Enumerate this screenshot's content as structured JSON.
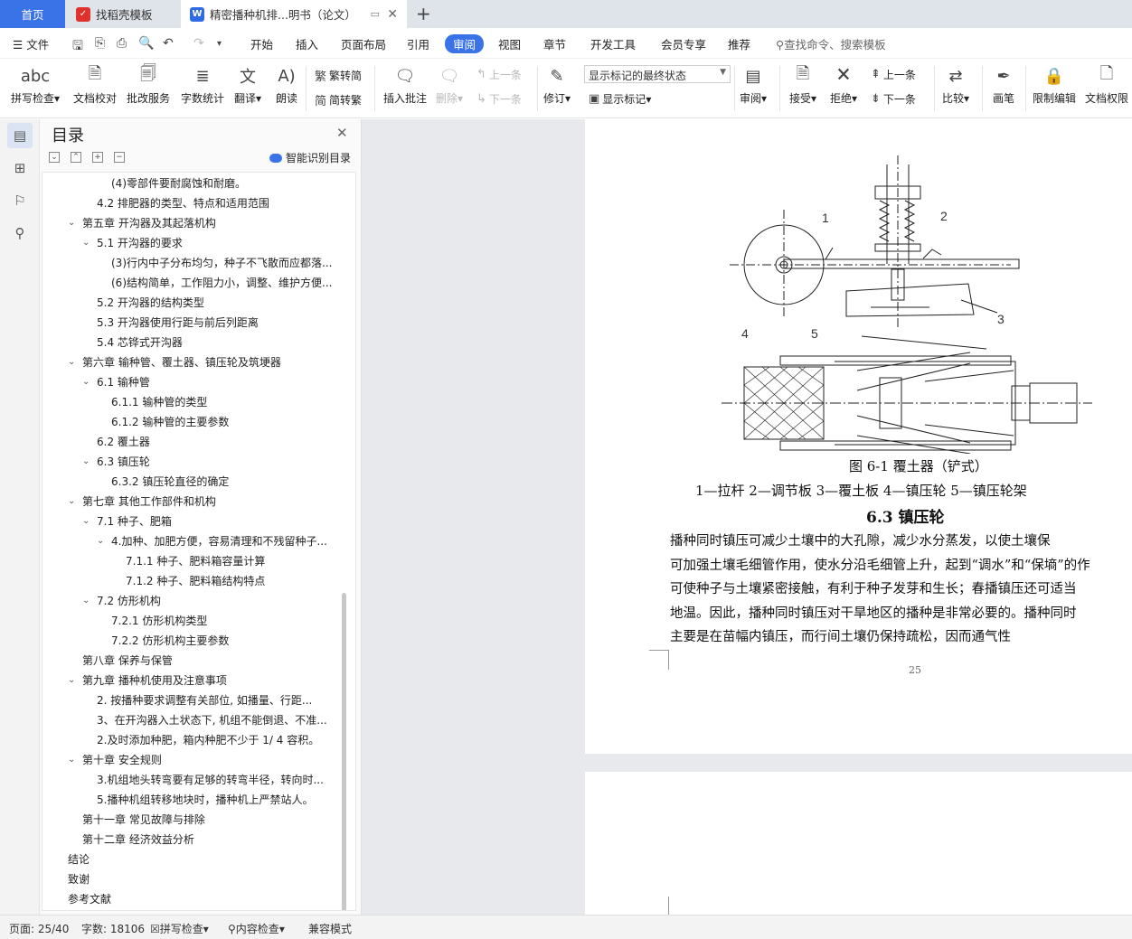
{
  "tabs": {
    "home": "首页",
    "t1": "找稻壳模板",
    "t2": "精密播种机排...明书（论文）"
  },
  "menu": {
    "file": "文件",
    "items": [
      "开始",
      "插入",
      "页面布局",
      "引用",
      "审阅",
      "视图",
      "章节",
      "开发工具",
      "会员专享",
      "推荐"
    ],
    "active": "审阅",
    "search": "查找命令、搜索模板"
  },
  "ribbon": {
    "spell": "拼写检查",
    "proof": "文档校对",
    "batch": "批改服务",
    "wordcount": "字数统计",
    "translate": "翻译",
    "read": "朗读",
    "trad": "繁转简",
    "simp": "简转繁",
    "insert_comment": "插入批注",
    "delete": "删除",
    "prev": "上一条",
    "next": "下一条",
    "revise": "修订",
    "markup_state": "显示标记的最终状态",
    "show_markup": "显示标记",
    "review": "审阅",
    "accept": "接受",
    "reject": "拒绝",
    "prev2": "上一条",
    "next2": "下一条",
    "compare": "比较",
    "pen": "画笔",
    "restrict": "限制编辑",
    "perm": "文档权限"
  },
  "toc": {
    "title": "目录",
    "smart": "智能识别目录",
    "items": [
      {
        "text": "(4)零部件要耐腐蚀和耐磨。",
        "level": 3,
        "chev": ""
      },
      {
        "text": "4.2   排肥器的类型、特点和适用范围",
        "level": 2,
        "chev": ""
      },
      {
        "text": "第五章      开沟器及其起落机构",
        "level": 1,
        "chev": "v"
      },
      {
        "text": "5.1   开沟器的要求",
        "level": 2,
        "chev": "v"
      },
      {
        "text": "(3)行内中子分布均匀，种子不飞散而应都落...",
        "level": 3,
        "chev": ""
      },
      {
        "text": "(6)结构简单，工作阻力小，调整、维护方便...",
        "level": 3,
        "chev": ""
      },
      {
        "text": "5.2   开沟器的结构类型",
        "level": 2,
        "chev": ""
      },
      {
        "text": "5.3   开沟器使用行距与前后列距离",
        "level": 2,
        "chev": ""
      },
      {
        "text": "5.4   芯铧式开沟器",
        "level": 2,
        "chev": ""
      },
      {
        "text": "第六章      输种管、覆土器、镇压轮及筑埂器",
        "level": 1,
        "chev": "v"
      },
      {
        "text": "6.1   输种管",
        "level": 2,
        "chev": "v"
      },
      {
        "text": "6.1.1   输种管的类型",
        "level": 3,
        "chev": ""
      },
      {
        "text": "6.1.2   输种管的主要参数",
        "level": 3,
        "chev": ""
      },
      {
        "text": "6.2   覆土器",
        "level": 2,
        "chev": ""
      },
      {
        "text": "6.3   镇压轮",
        "level": 2,
        "chev": "v"
      },
      {
        "text": "6.3.2   镇压轮直径的确定",
        "level": 3,
        "chev": ""
      },
      {
        "text": "第七章      其他工作部件和机构",
        "level": 1,
        "chev": "v"
      },
      {
        "text": "7.1   种子、肥箱",
        "level": 2,
        "chev": "v"
      },
      {
        "text": "4.加种、加肥方便，容易清理和不残留种子...",
        "level": 3,
        "chev": "v"
      },
      {
        "text": "7.1.1   种子、肥料箱容量计算",
        "level": 4,
        "chev": ""
      },
      {
        "text": "7.1.2   种子、肥料箱结构特点",
        "level": 4,
        "chev": ""
      },
      {
        "text": "7.2   仿形机构",
        "level": 2,
        "chev": "v"
      },
      {
        "text": "7.2.1   仿形机构类型",
        "level": 3,
        "chev": ""
      },
      {
        "text": "7.2.2   仿形机构主要参数",
        "level": 3,
        "chev": ""
      },
      {
        "text": "第八章   保养与保管",
        "level": 1,
        "chev": ""
      },
      {
        "text": "第九章   播种机使用及注意事项",
        "level": 1,
        "chev": "v"
      },
      {
        "text": "2.   按播种要求调整有关部位, 如播量、行距...",
        "level": 2,
        "chev": ""
      },
      {
        "text": "3、在开沟器入土状态下, 机组不能倒退、不准...",
        "level": 2,
        "chev": ""
      },
      {
        "text": "2.及时添加种肥，箱内种肥不少于  1/ 4 容积。",
        "level": 2,
        "chev": ""
      },
      {
        "text": "第十章   安全规则",
        "level": 1,
        "chev": "v"
      },
      {
        "text": "3.机组地头转弯要有足够的转弯半径，转向时...",
        "level": 2,
        "chev": ""
      },
      {
        "text": "5.播种机组转移地块时，播种机上严禁站人。",
        "level": 2,
        "chev": ""
      },
      {
        "text": "第十一章   常见故障与排除",
        "level": 1,
        "chev": ""
      },
      {
        "text": "第十二章   经济效益分析",
        "level": 1,
        "chev": ""
      },
      {
        "text": "结论",
        "level": 0,
        "chev": ""
      },
      {
        "text": "致谢",
        "level": 0,
        "chev": ""
      },
      {
        "text": "参考文献",
        "level": 0,
        "chev": ""
      }
    ]
  },
  "doc": {
    "drawing_labels": [
      "1",
      "2",
      "3",
      "4",
      "5"
    ],
    "figure_caption": "图 6-1    覆土器（铲式）",
    "figure_legend": "1—拉杆    2—调节板    3—覆土板    4—镇压轮    5—镇压轮架",
    "section_title": "6.3    镇压轮",
    "paragraph": [
      "    播种同时镇压可减少土壤中的大孔隙，减少水分蒸发，以使土壤保",
      "可加强土壤毛细管作用，使水分沿毛细管上升，起到“调水”和“保墒”的作",
      "可使种子与土壤紧密接触，有利于种子发芽和生长；春播镇压还可适当",
      "地温。因此，播种同时镇压对干旱地区的播种是非常必要的。播种同时",
      "主要是在苗幅内镇压，而行间土壤仍保持疏松，因而通气性"
    ],
    "page_number": "25"
  },
  "status": {
    "page": "页面: 25/40",
    "words": "字数: 18106",
    "spell": "拼写检查",
    "content": "内容检查",
    "compat": "兼容模式"
  }
}
